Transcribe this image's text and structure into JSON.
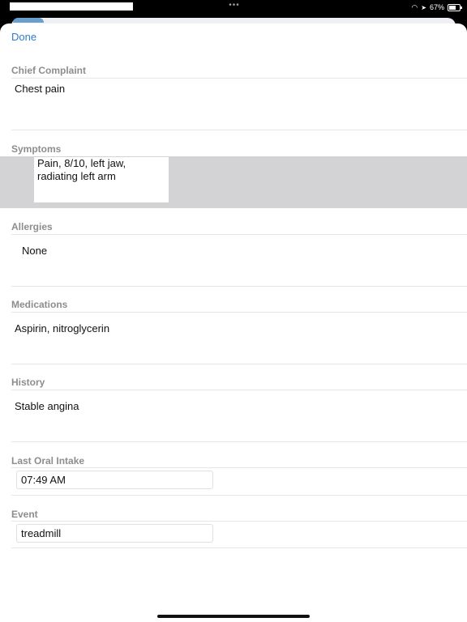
{
  "status_bar": {
    "dots": "•••",
    "wifi_icon": "wifi-icon",
    "location_icon": "location-arrow-icon",
    "battery_label": "67%",
    "battery_level": 0.67
  },
  "toolbar": {
    "done_label": "Done"
  },
  "sections": {
    "chief_complaint": {
      "header": "Chief Complaint",
      "value": "Chest pain"
    },
    "symptoms": {
      "header": "Symptoms",
      "value": "Pain, 8/10, left jaw, radiating left arm"
    },
    "allergies": {
      "header": "Allergies",
      "value": "None"
    },
    "medications": {
      "header": "Medications",
      "value": "Aspirin, nitroglycerin"
    },
    "history": {
      "header": "History",
      "value": "Stable angina"
    },
    "last_oral_intake": {
      "header": "Last Oral Intake",
      "value": "07:49 AM"
    },
    "event": {
      "header": "Event",
      "value": "treadmill"
    }
  },
  "colors": {
    "accent": "#2f7bc9",
    "header_gray": "#8d8d90",
    "selection_band": "#d3d3d6"
  }
}
